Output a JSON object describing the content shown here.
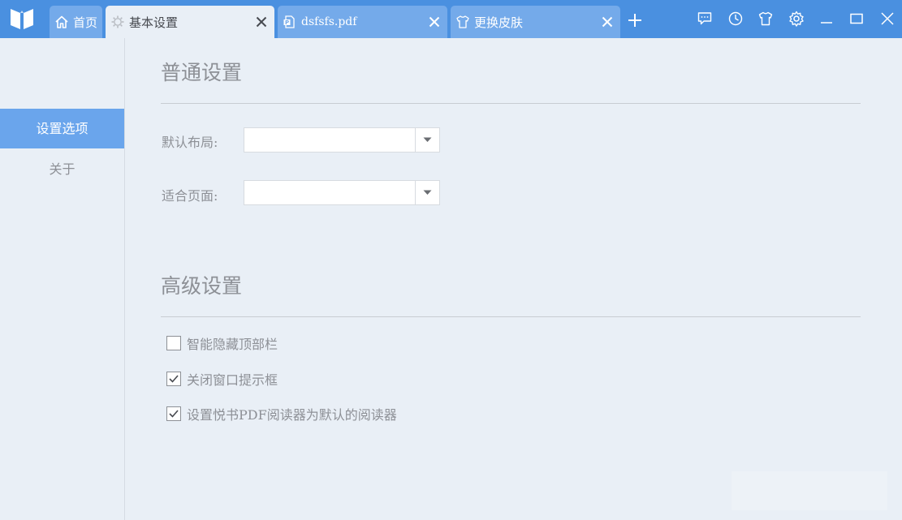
{
  "tabs": [
    {
      "label": "首页",
      "icon": "home-icon",
      "active": false,
      "closable": false
    },
    {
      "label": "基本设置",
      "icon": "gear-icon",
      "active": true,
      "closable": true
    },
    {
      "label": "dsfsfs.pdf",
      "icon": "pdf-file-icon",
      "active": false,
      "closable": true
    },
    {
      "label": "更换皮肤",
      "icon": "shirt-icon",
      "active": false,
      "closable": true
    }
  ],
  "window_controls": [
    "feedback-icon",
    "history-icon",
    "skin-icon",
    "settings-icon",
    "minimize-icon",
    "maximize-icon",
    "close-icon"
  ],
  "sidebar": {
    "items": [
      {
        "label": "设置选项",
        "active": true
      },
      {
        "label": "关于",
        "active": false
      }
    ]
  },
  "general": {
    "title": "普通设置",
    "default_layout_label": "默认布局:",
    "default_layout_value": "",
    "fit_page_label": "适合页面:",
    "fit_page_value": ""
  },
  "advanced": {
    "title": "高级设置",
    "options": [
      {
        "label": "智能隐藏顶部栏",
        "checked": false
      },
      {
        "label": "关闭窗口提示框",
        "checked": true
      },
      {
        "label": "设置悦书PDF阅读器为默认的阅读器",
        "checked": true
      }
    ]
  },
  "colors": {
    "titlebar": "#4a90e0",
    "tab_inactive": "#74aaea",
    "sidebar_active": "#6aa5ec",
    "background": "#e9eff6"
  }
}
